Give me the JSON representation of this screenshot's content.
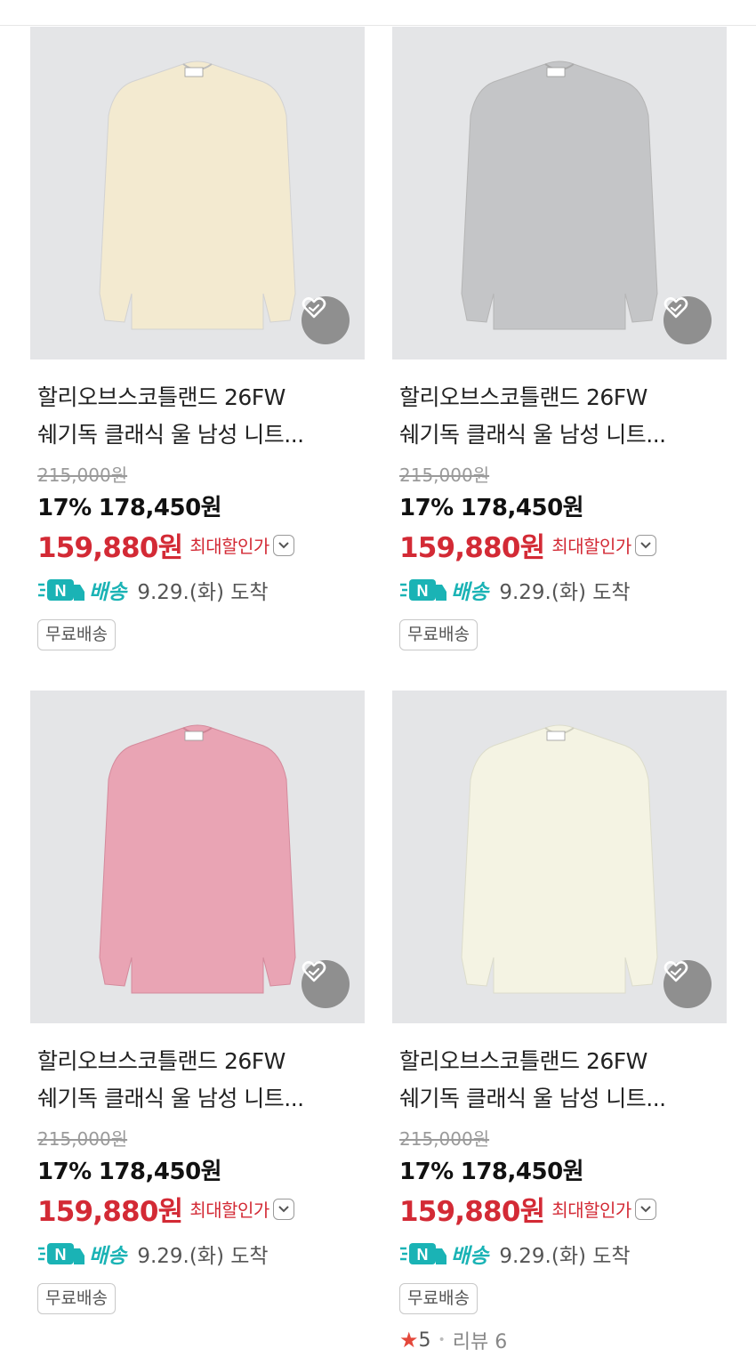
{
  "products": [
    {
      "title_line1": "할리오브스코틀랜드 26FW",
      "title_line2": "쉐기독 클래식 울 남성 니트...",
      "original_price": "215,000원",
      "discount_rate": "17%",
      "sale_price": "178,450원",
      "max_discount_price": "159,880원",
      "max_discount_label": "최대할인가",
      "shipping_badge": "N",
      "shipping_label": "배송",
      "shipping_date": "9.29.(화) 도착",
      "tag": "무료배송",
      "sweater_color": "#f3ead0"
    },
    {
      "title_line1": "할리오브스코틀랜드 26FW",
      "title_line2": "쉐기독 클래식 울 남성 니트...",
      "original_price": "215,000원",
      "discount_rate": "17%",
      "sale_price": "178,450원",
      "max_discount_price": "159,880원",
      "max_discount_label": "최대할인가",
      "shipping_badge": "N",
      "shipping_label": "배송",
      "shipping_date": "9.29.(화) 도착",
      "tag": "무료배송",
      "sweater_color": "#c4c5c7"
    },
    {
      "title_line1": "할리오브스코틀랜드 26FW",
      "title_line2": "쉐기독 클래식 울 남성 니트...",
      "original_price": "215,000원",
      "discount_rate": "17%",
      "sale_price": "178,450원",
      "max_discount_price": "159,880원",
      "max_discount_label": "최대할인가",
      "shipping_badge": "N",
      "shipping_label": "배송",
      "shipping_date": "9.29.(화) 도착",
      "tag": "무료배송",
      "sweater_color": "#e9a4b4"
    },
    {
      "title_line1": "할리오브스코틀랜드 26FW",
      "title_line2": "쉐기독 클래식 울 남성 니트...",
      "original_price": "215,000원",
      "discount_rate": "17%",
      "sale_price": "178,450원",
      "max_discount_price": "159,880원",
      "max_discount_label": "최대할인가",
      "shipping_badge": "N",
      "shipping_label": "배송",
      "shipping_date": "9.29.(화) 도착",
      "tag": "무료배송",
      "rating": "5",
      "review_label": "리뷰 6",
      "sweater_color": "#f4f3e3"
    }
  ],
  "colors": {
    "accent_red": "#d32a35",
    "shipping_teal": "#1ab3b5",
    "star": "#e4483b",
    "thumb_bg": "#e4e5e7"
  }
}
